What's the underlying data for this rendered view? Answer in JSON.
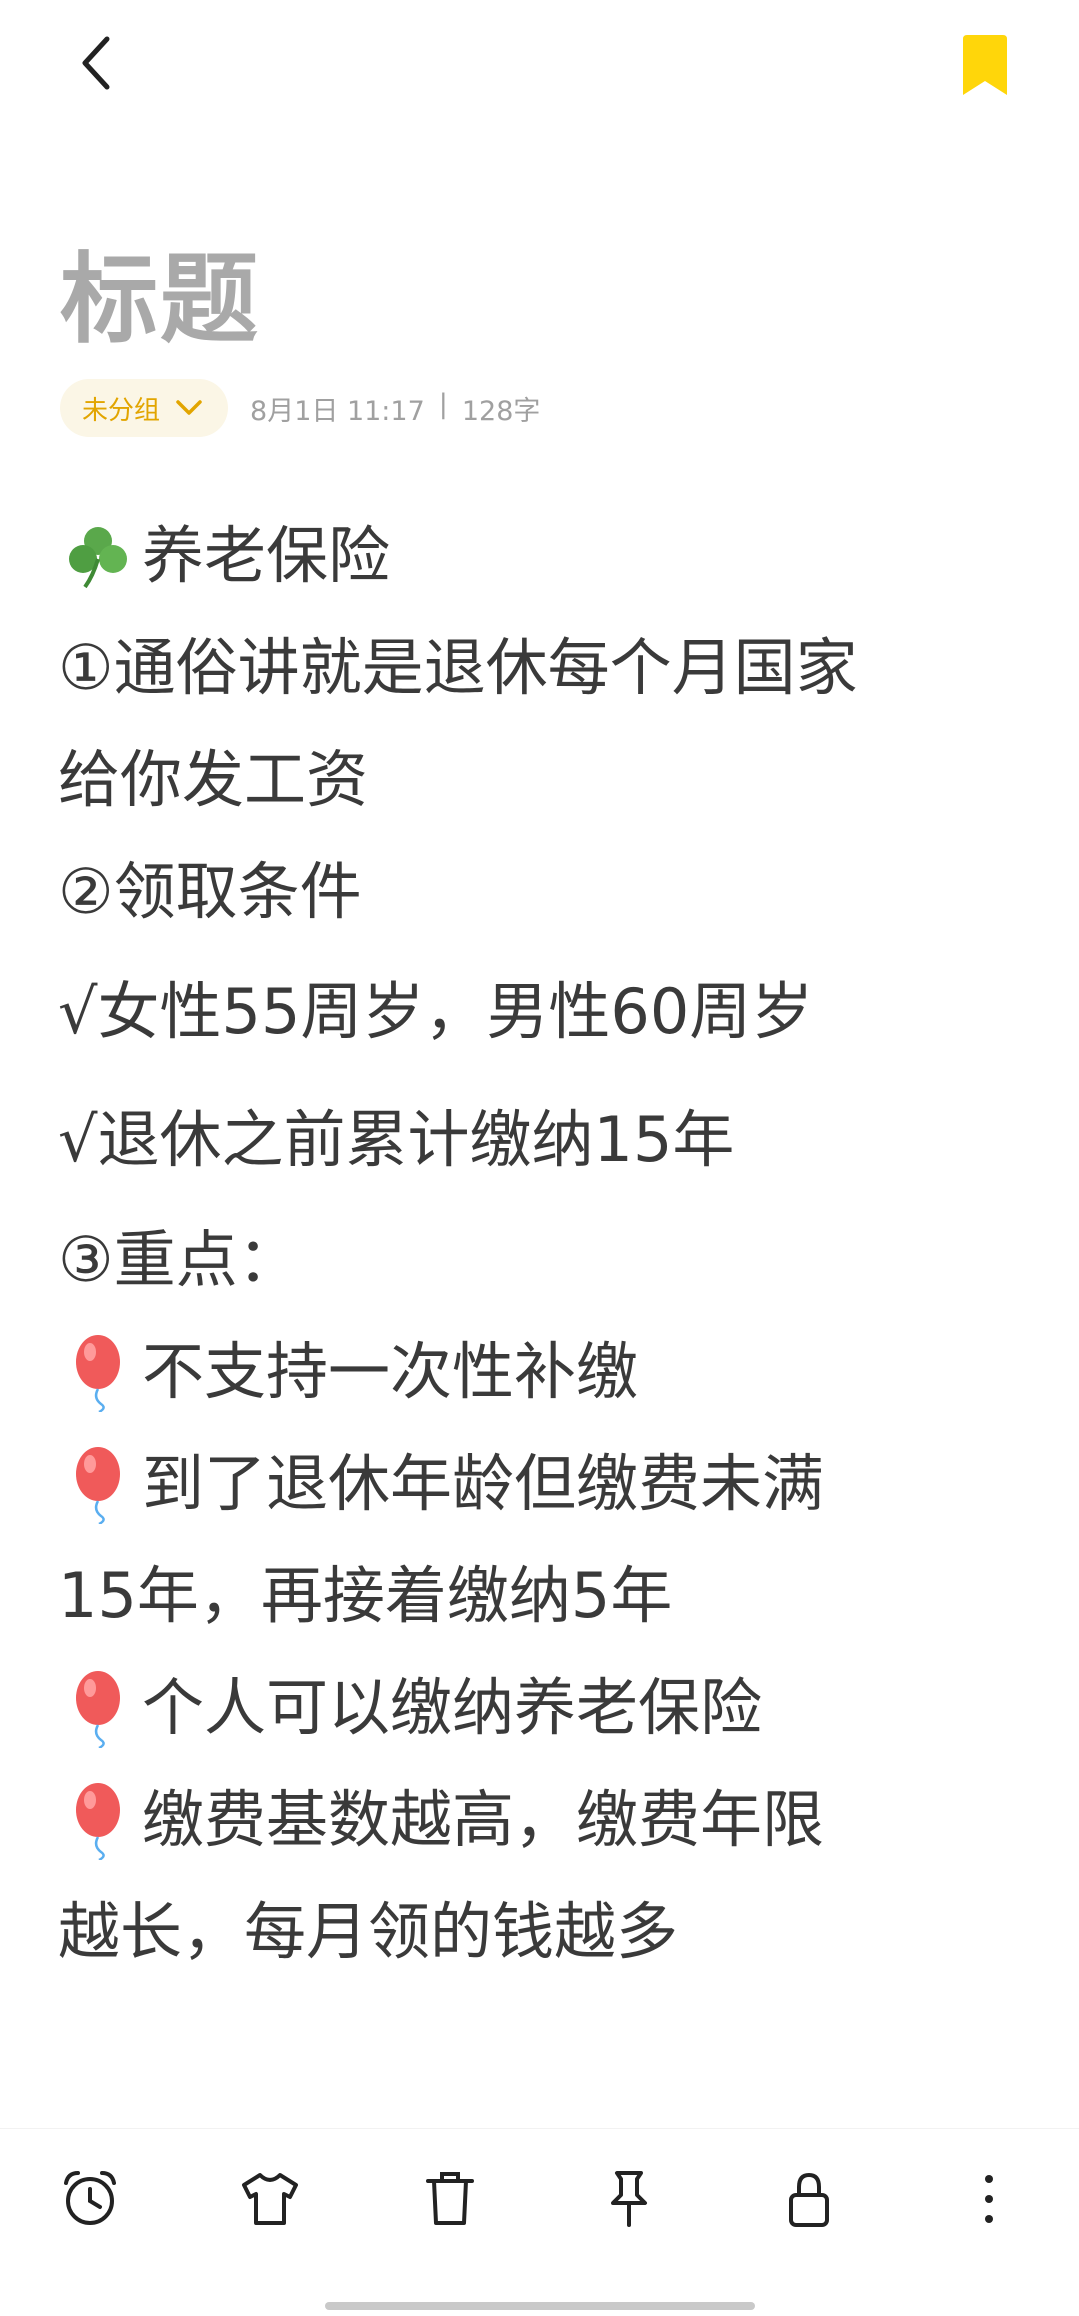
{
  "header": {
    "back_icon": "chevron-left-icon",
    "bookmark_icon": "bookmark-icon",
    "bookmark_color": "#FFD60A"
  },
  "note": {
    "title": "标题",
    "group": "未分组",
    "date": "8月1日 11:17",
    "separator": "|",
    "char_count": "128字",
    "lines": [
      {
        "emoji": "clover",
        "text": "养老保险"
      },
      {
        "emoji": "",
        "text": "①通俗讲就是退休每个月国家"
      },
      {
        "emoji": "",
        "text": "给你发工资"
      },
      {
        "emoji": "",
        "text": "②领取条件"
      },
      {
        "emoji": "",
        "text": "√女性55周岁，男性60周岁"
      },
      {
        "emoji": "",
        "text": "√退休之前累计缴纳15年"
      },
      {
        "emoji": "",
        "text": "③重点："
      },
      {
        "emoji": "balloon",
        "text": "不支持一次性补缴"
      },
      {
        "emoji": "balloon",
        "text": "到了退休年龄但缴费未满"
      },
      {
        "emoji": "",
        "text": "15年，再接着缴纳5年"
      },
      {
        "emoji": "balloon",
        "text": "个人可以缴纳养老保险"
      },
      {
        "emoji": "balloon",
        "text": "缴费基数越高，缴费年限"
      },
      {
        "emoji": "",
        "text": "越长，每月领的钱越多"
      }
    ]
  },
  "toolbar": {
    "items": [
      "alarm-clock-icon",
      "t-shirt-icon",
      "trash-icon",
      "pin-icon",
      "lock-icon",
      "more-vertical-icon"
    ]
  },
  "colors": {
    "accent": "#E2A500",
    "title_gray": "#A9A9A9",
    "text": "#3A3A3A"
  }
}
